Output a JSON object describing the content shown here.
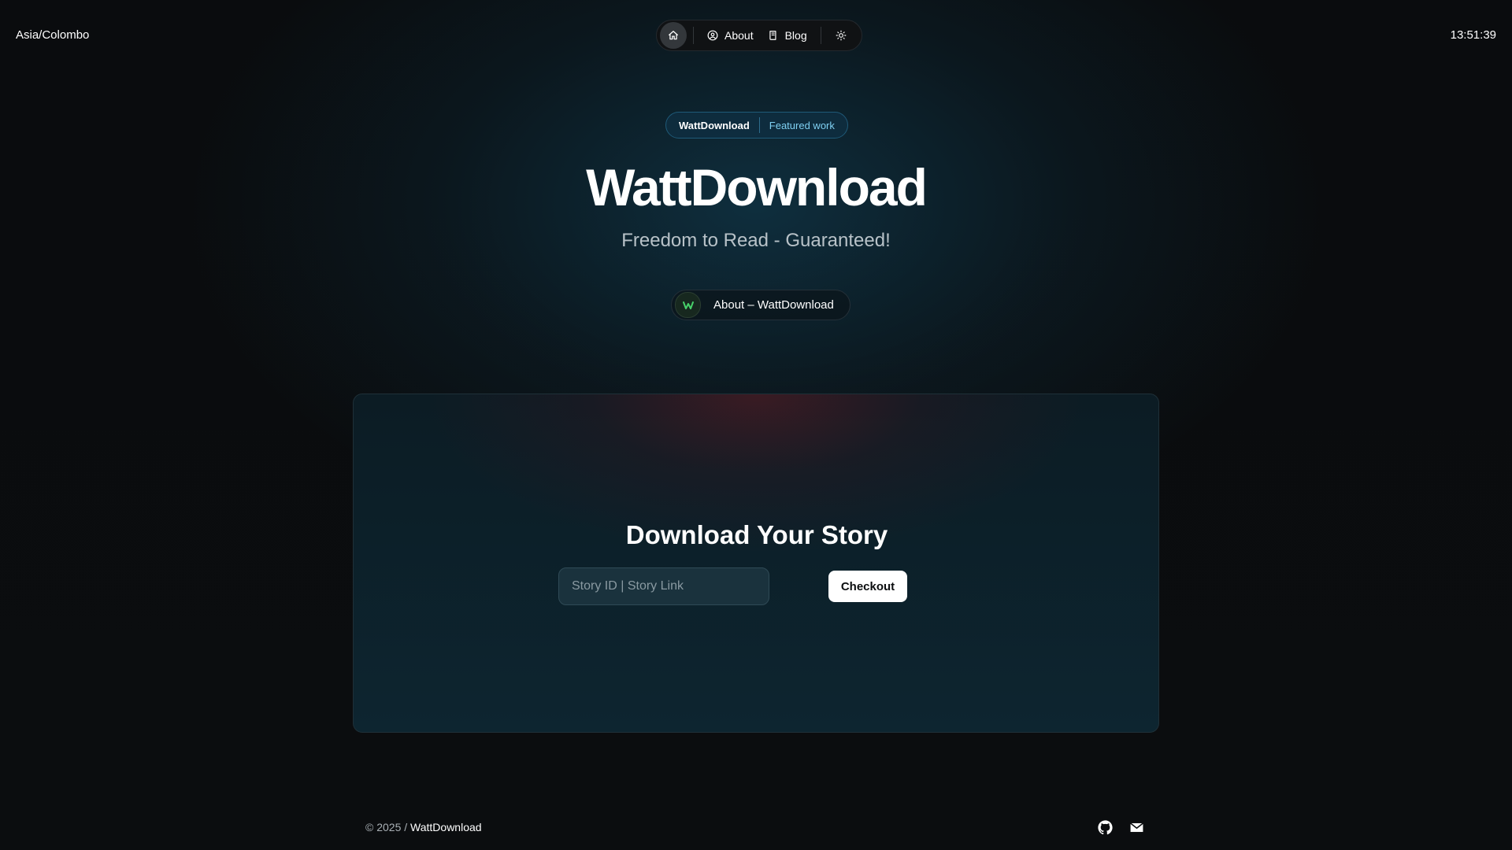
{
  "topbar": {
    "timezone": "Asia/Colombo",
    "clock": "13:51:39"
  },
  "nav": {
    "items": [
      {
        "label": "About",
        "icon": "user-circle-icon"
      },
      {
        "label": "Blog",
        "icon": "book-icon"
      }
    ],
    "home_icon": "home-icon",
    "theme_icon": "sun-icon"
  },
  "hero": {
    "badge_title": "WattDownload",
    "badge_link": "Featured work",
    "title": "WattDownload",
    "subtitle": "Freedom to Read - Guaranteed!",
    "about_link": "About – WattDownload",
    "about_avatar": "W"
  },
  "download": {
    "title": "Download Your Story",
    "input_placeholder": "Story ID | Story Link",
    "input_value": "",
    "button_label": "Checkout"
  },
  "footer": {
    "copyright": "© 2025 /",
    "brand": "WattDownload",
    "icons": [
      "github-icon",
      "mail-icon"
    ]
  },
  "colors": {
    "accent": "#7fd0f2",
    "background": "#0b0d0f",
    "card": "#0d2530"
  }
}
